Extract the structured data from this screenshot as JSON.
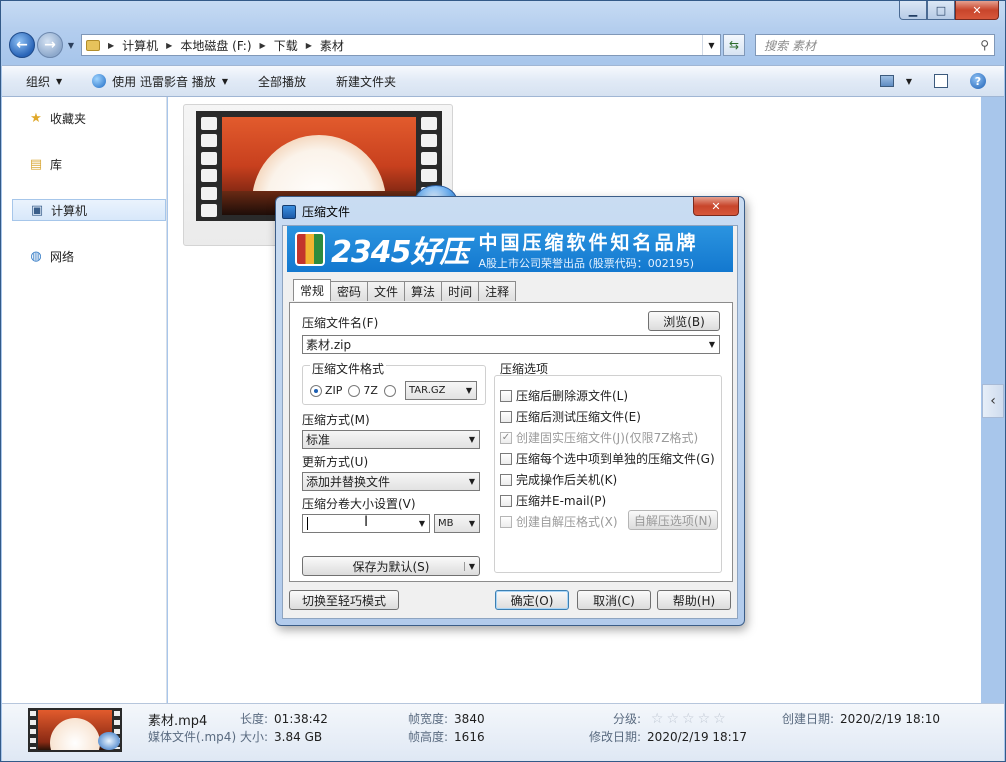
{
  "window": {
    "min": "▁",
    "max": "□",
    "close": "✕"
  },
  "address": {
    "crumbs": [
      "计算机",
      "本地磁盘 (F:)",
      "下载",
      "素材"
    ],
    "search_placeholder": "搜索 素材"
  },
  "toolbar": {
    "organize": "组织",
    "play_with": "使用 迅雷影音 播放",
    "play_all": "全部播放",
    "new_folder": "新建文件夹"
  },
  "sidebar": {
    "items": [
      {
        "label": "收藏夹",
        "icon": "star-icon"
      },
      {
        "label": "库",
        "icon": "library-icon"
      },
      {
        "label": "计算机",
        "icon": "computer-icon"
      },
      {
        "label": "网络",
        "icon": "network-icon"
      }
    ]
  },
  "details": {
    "filename": "素材.mp4",
    "filetype": "媒体文件(.mp4)",
    "length_label": "长度:",
    "length": "01:38:42",
    "size_label": "大小:",
    "size": "3.84 GB",
    "frame_width_label": "帧宽度:",
    "frame_width": "3840",
    "frame_height_label": "帧高度:",
    "frame_height": "1616",
    "rating_label": "分级:",
    "rating": 0,
    "modified_label": "修改日期:",
    "modified": "2020/2/19 18:17",
    "created_label": "创建日期:",
    "created": "2020/2/19 18:10"
  },
  "dialog": {
    "title": "压缩文件",
    "banner": {
      "brand": "2345好压",
      "slogan": "中国压缩软件知名品牌",
      "sub": "A股上市公司荣誉出品 (股票代码：002195)"
    },
    "tabs": [
      "常规",
      "密码",
      "文件",
      "算法",
      "时间",
      "注释"
    ],
    "filename_label": "压缩文件名(F)",
    "browse": "浏览(B)",
    "filename_value": "素材.zip",
    "format_label": "压缩文件格式",
    "formats": [
      "ZIP",
      "7Z",
      "TAR.GZ"
    ],
    "method_label": "压缩方式(M)",
    "method_value": "标准",
    "update_label": "更新方式(U)",
    "update_value": "添加并替换文件",
    "split_label": "压缩分卷大小设置(V)",
    "split_value": "",
    "split_unit": "MB",
    "save_default": "保存为默认(S)",
    "options_label": "压缩选项",
    "options": [
      "压缩后删除源文件(L)",
      "压缩后测试压缩文件(E)",
      "创建固实压缩文件(J)(仅限7Z格式)",
      "压缩每个选中项到单独的压缩文件(G)",
      "完成操作后关机(K)",
      "压缩并E-mail(P)",
      "创建自解压格式(X)"
    ],
    "sfx_options": "自解压选项(N)",
    "switch_mode": "切换至轻巧模式",
    "ok": "确定(O)",
    "cancel": "取消(C)",
    "help": "帮助(H)"
  }
}
